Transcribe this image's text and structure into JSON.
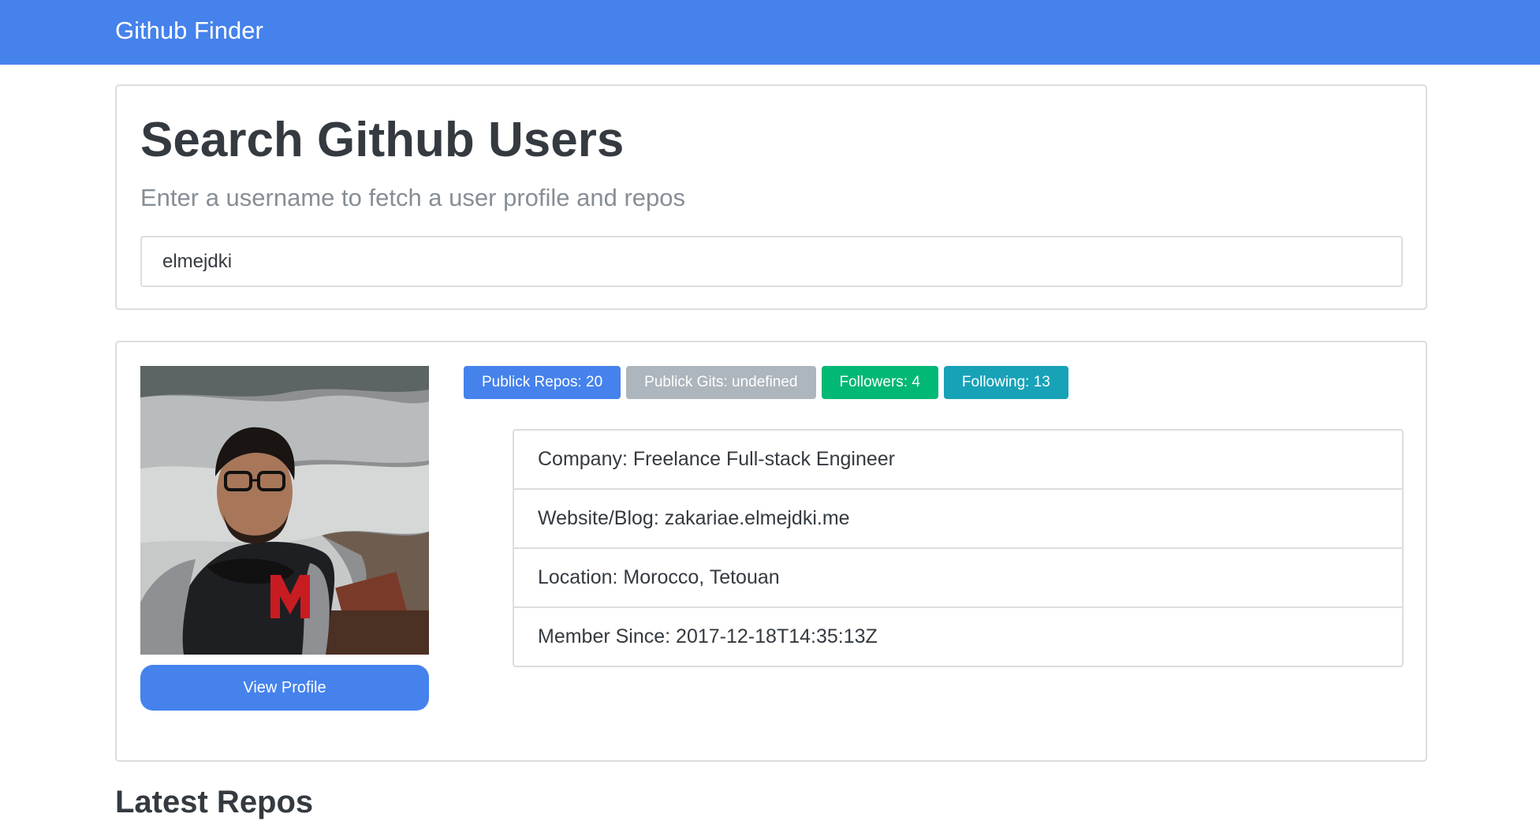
{
  "navbar": {
    "brand": "Github Finder"
  },
  "search": {
    "heading": "Search Github Users",
    "lead": "Enter a username to fetch a user profile and repos",
    "input_value": "elmejdki"
  },
  "profile": {
    "avatar_alt": "avatar",
    "view_profile_label": "View Profile",
    "badges": {
      "repos": "Publick Repos: 20",
      "gists": "Publick Gits: undefined",
      "followers": "Followers: 4",
      "following": "Following: 13"
    },
    "details": {
      "company": "Company: Freelance Full-stack Engineer",
      "website": "Website/Blog: zakariae.elmejdki.me",
      "location": "Location: Morocco, Tetouan",
      "member_since": "Member Since: 2017-12-18T14:35:13Z"
    }
  },
  "repos": {
    "title": "Latest Repos"
  },
  "colors": {
    "primary": "#4582ec",
    "secondary": "#adb5bd",
    "success": "#02b875",
    "info": "#17a2b8",
    "text": "#343a40",
    "muted": "#868e96"
  }
}
